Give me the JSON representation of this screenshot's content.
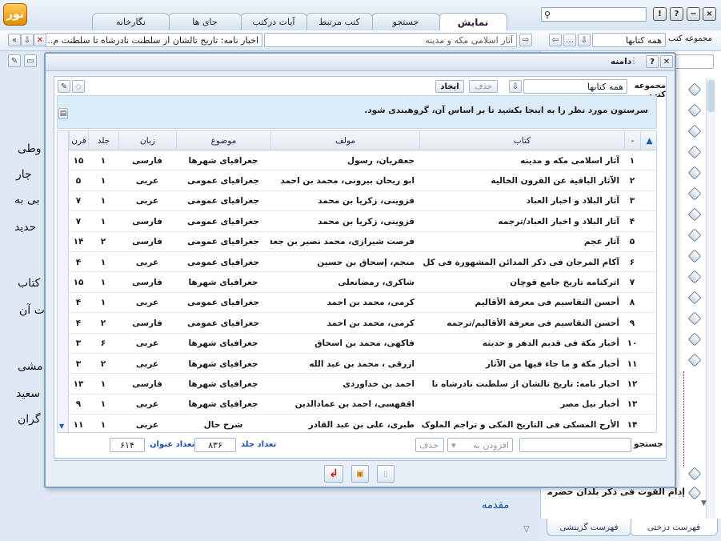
{
  "app": {
    "logo_text": "نور"
  },
  "tabs": [
    {
      "label": "نمایش",
      "active": true
    },
    {
      "label": "جستجو"
    },
    {
      "label": "کتب مرتبط"
    },
    {
      "label": "آیات درکتب"
    },
    {
      "label": "جای ها"
    },
    {
      "label": "نگارخانه"
    }
  ],
  "window_buttons": {
    "close": "×",
    "minimize": "−",
    "help": "?",
    "info": "!"
  },
  "toolbar": {
    "collection_label": "مجموعه کتب",
    "collection_value": "همه کتابها",
    "book_title": "آثار اسلامی مکه و مدینه",
    "breadcrumb": "اخبار نامه: تاریخ تالشان از سلطنت نادرشاه تا سلطنت م..."
  },
  "background_text": [
    "وطی",
    "چار",
    "بی به",
    "حدید",
    "کتاب",
    "ت آن",
    "مشی",
    "سعید",
    "گران"
  ],
  "background_link": "مقدمه",
  "right_pane": {
    "tree_bottom_item": "إدام القوت فی ذکر بلدان حضرموت",
    "tabs": [
      "فهرست درختی",
      "فهرست گزینشی"
    ]
  },
  "dialog": {
    "title": "دامنه",
    "collection_label": "مجموعه کتب",
    "collection_value": "همه کتابها",
    "delete_label": "حذف",
    "create_label": "ایجاد",
    "hint": "سرستون مورد نظر را به اینجا بکشید تا بر اساس آن، گروهبندی شود.",
    "columns": {
      "index": "-",
      "book": "کتاب",
      "author": "مولف",
      "subject": "موضوع",
      "language": "زبان",
      "volume": "جلد",
      "century": "قرن"
    },
    "rows": [
      {
        "idx": "۱",
        "book": "آثار اسلامی مکه و مدینه",
        "author": "جعفریان، رسول",
        "subject": "جغرافیای شهرها",
        "lang": "فارسی",
        "vol": "۱",
        "century": "۱۵"
      },
      {
        "idx": "۲",
        "book": "الآثار الباقية عن القرون الخالية",
        "author": "ابو ریحان بیرونی، محمد بن احمد",
        "subject": "جغرافیای عمومی",
        "lang": "عربی",
        "vol": "۱",
        "century": "۵"
      },
      {
        "idx": "۳",
        "book": "آثار البلاد و اخبار العباد",
        "author": "قزوینی، زکریا بن محمد",
        "subject": "جغرافیای عمومی",
        "lang": "عربی",
        "vol": "۱",
        "century": "۷"
      },
      {
        "idx": "۴",
        "book": "آثار البلاد و اخبار العباد/ترجمه",
        "author": "قزوینی، زکریا بن محمد",
        "subject": "جغرافیای عمومی",
        "lang": "فارسی",
        "vol": "۱",
        "century": "۷"
      },
      {
        "idx": "۵",
        "book": "آثار عجم",
        "author": "فرصت شیرازی، محمد نصیر بن جعفر",
        "subject": "جغرافیای عمومی",
        "lang": "فارسی",
        "vol": "۲",
        "century": "۱۴"
      },
      {
        "idx": "۶",
        "book": "آکام المرجان فی ذکر المدائن المشهورة فی کل",
        "author": "منجم، إسحاق بن حسين",
        "subject": "جغرافیای عمومی",
        "lang": "عربی",
        "vol": "۱",
        "century": "۴"
      },
      {
        "idx": "۷",
        "book": "اترکنامه تاریخ جامع قوچان",
        "author": "شاکری، رمضانعلی",
        "subject": "جغرافیای شهرها",
        "lang": "فارسی",
        "vol": "۱",
        "century": "۱۵"
      },
      {
        "idx": "۸",
        "book": "أحسن التقاسیم فی معرفة الأقالیم",
        "author": "کرمی، محمد بن احمد",
        "subject": "جغرافیای عمومی",
        "lang": "عربی",
        "vol": "۱",
        "century": "۴"
      },
      {
        "idx": "۹",
        "book": "أحسن التقاسیم فی معرفة الأقالیم/ترجمه",
        "author": "کرمی، محمد بن احمد",
        "subject": "جغرافیای عمومی",
        "lang": "فارسی",
        "vol": "۲",
        "century": "۴"
      },
      {
        "idx": "۱۰",
        "book": "أخبار مکة فی قدیم الدهر و حدیثه",
        "author": "فاکهی، محمد بن اسحاق",
        "subject": "جغرافیای شهرها",
        "lang": "عربی",
        "vol": "۶",
        "century": "۳"
      },
      {
        "idx": "۱۱",
        "book": "أخبار مکة و ما جاء فیها من الآثار",
        "author": "ازرقی ، محمد بن عبد الله",
        "subject": "جغرافیای شهرها",
        "lang": "عربی",
        "vol": "۲",
        "century": "۳"
      },
      {
        "idx": "۱۲",
        "book": "اخبار نامه: تاریخ تالشان از سلطنت نادرشاه تا",
        "author": "احمد بن خداوردی",
        "subject": "جغرافیای شهرها",
        "lang": "فارسی",
        "vol": "۱",
        "century": "۱۳"
      },
      {
        "idx": "۱۳",
        "book": "أخبار نیل مصر",
        "author": "اقفهسی، احمد بن عمادالدین",
        "subject": "جغرافیای شهرها",
        "lang": "عربی",
        "vol": "۱",
        "century": "۹"
      },
      {
        "idx": "۱۴",
        "book": "الأرج المسکی فی التاریخ المکی و تراجم الملوک و",
        "author": "طبری، علی بن عبد القادر",
        "subject": "شرح حال",
        "lang": "عربی",
        "vol": "۱",
        "century": "۱۱"
      }
    ],
    "search_label": "جستجو",
    "add_label": "افزودن به",
    "delete2_label": "حذف",
    "volume_count_label": "تعداد جلد",
    "volume_count": "۸۳۶",
    "title_count_label": "تعداد عنوان",
    "title_count": "۶۱۴"
  }
}
